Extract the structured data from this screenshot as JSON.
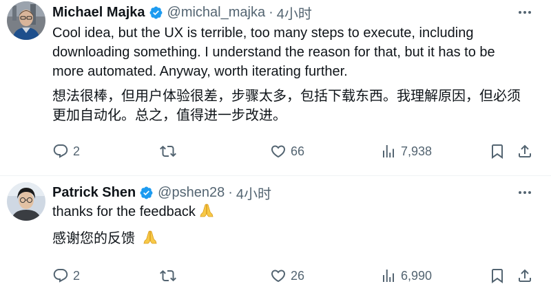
{
  "tweets": [
    {
      "display_name": "Michael Majka",
      "handle": "@michal_majka",
      "separator": "·",
      "time": "4小时",
      "text_en": [
        "Cool idea, but the UX is terrible, too many steps to execute, including",
        "downloading something. I understand the reason for that, but it has to be",
        "more automated. Anyway, worth iterating further."
      ],
      "text_zh": [
        "想法很棒，但用户体验很差，步骤太多，包括下载东西。我理解原因，但必须",
        "更加自动化。总之，值得进一步改进。"
      ],
      "replies": "2",
      "retweets": "",
      "likes": "66",
      "views": "7,938"
    },
    {
      "display_name": "Patrick Shen",
      "handle": "@pshen28",
      "separator": "·",
      "time": "4小时",
      "text_en": [
        "thanks for the feedback"
      ],
      "text_zh": [
        "感谢您的反馈"
      ],
      "replies": "2",
      "retweets": "",
      "likes": "26",
      "views": "6,990"
    }
  ],
  "icons": {
    "verified": "verified-badge-icon",
    "more": "more-options-icon",
    "reply": "reply-icon",
    "retweet": "retweet-icon",
    "like": "heart-icon",
    "views": "views-chart-icon",
    "bookmark": "bookmark-icon",
    "share": "share-icon",
    "emoji": "folded-hands-emoji"
  },
  "colors": {
    "text_primary": "#0f1419",
    "text_secondary": "#536471",
    "verified_blue": "#1d9bf0",
    "divider": "#eff3f4",
    "emoji_yellow": "#f7c948"
  }
}
